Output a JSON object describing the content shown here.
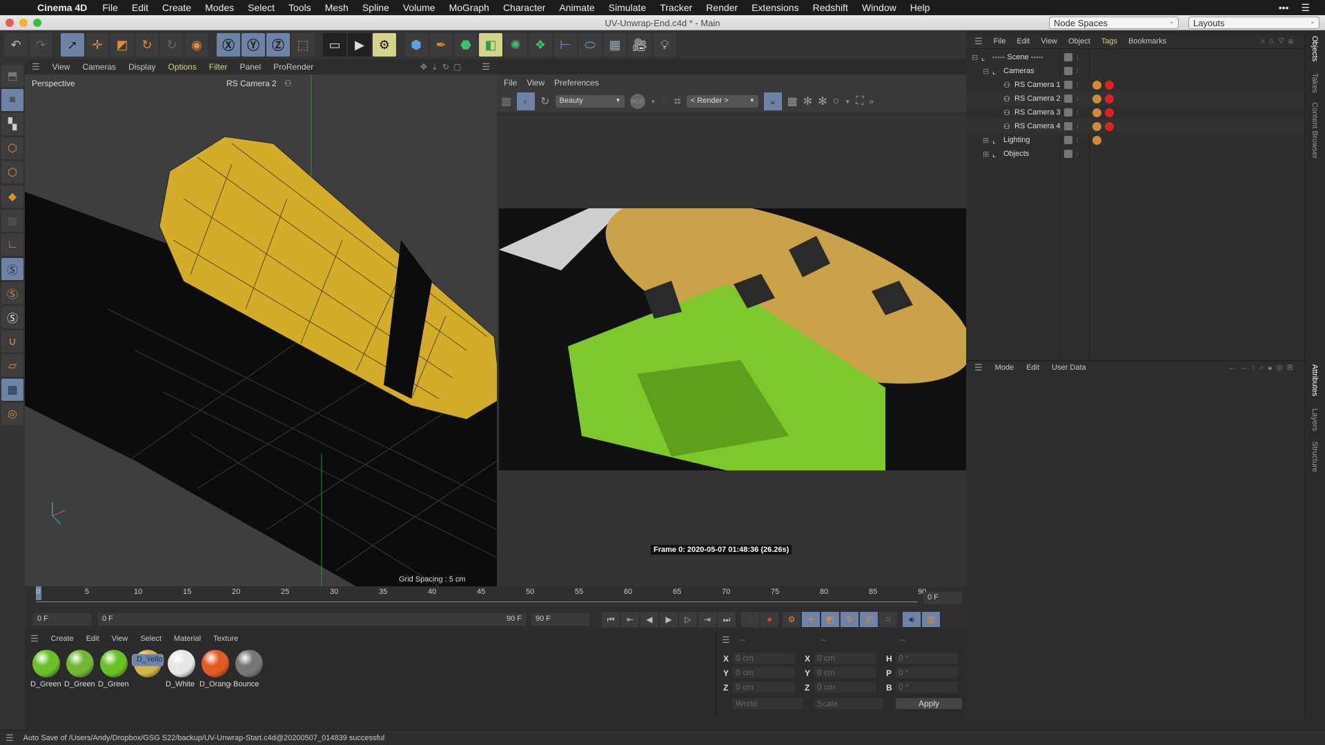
{
  "menubar": {
    "app": "Cinema 4D",
    "items": [
      "File",
      "Edit",
      "Create",
      "Modes",
      "Select",
      "Tools",
      "Mesh",
      "Spline",
      "Volume",
      "MoGraph",
      "Character",
      "Animate",
      "Simulate",
      "Tracker",
      "Render",
      "Extensions",
      "Redshift",
      "Window",
      "Help"
    ]
  },
  "window": {
    "title": "UV-Unwrap-End.c4d * - Main",
    "node_spaces": "Node Spaces",
    "layouts": "Layouts"
  },
  "toolbar": {
    "icons": [
      "undo-icon",
      "redo-icon",
      "live-selection-icon",
      "move-icon",
      "scale-icon",
      "rotate-icon",
      "recent-tool-icon",
      "selection-icon",
      "x-axis-icon",
      "y-axis-icon",
      "z-axis-icon",
      "coordinate-system-icon",
      "render-view-icon",
      "render-picture-viewer-icon",
      "render-settings-icon",
      "cube-icon",
      "pen-icon",
      "subdivision-icon",
      "extrude-icon",
      "cloner-icon",
      "array-icon",
      "deformer-icon",
      "field-icon",
      "floor-icon",
      "camera-icon",
      "light-icon"
    ]
  },
  "viewport": {
    "menu": [
      "View",
      "Cameras",
      "Display",
      "Options",
      "Filter",
      "Panel",
      "ProRender"
    ],
    "name": "Perspective",
    "camera": "RS Camera 2",
    "grid_spacing": "Grid Spacing : 5 cm"
  },
  "render_view": {
    "menu": [
      "File",
      "View",
      "Preferences"
    ],
    "aov": "Beauty",
    "channel": "RGB",
    "render_target": "< Render >",
    "frame_info": "Frame  0:  2020-05-07  01:48:36  (26.26s)"
  },
  "object_manager": {
    "menu": [
      "File",
      "Edit",
      "View",
      "Object",
      "Tags",
      "Bookmarks"
    ],
    "objects": [
      {
        "name": "----- Scene -----",
        "level": 0,
        "expanded": true
      },
      {
        "name": "Cameras",
        "level": 1,
        "expanded": true
      },
      {
        "name": "RS Camera 1",
        "level": 2
      },
      {
        "name": "RS Camera 2",
        "level": 2
      },
      {
        "name": "RS Camera 3",
        "level": 2
      },
      {
        "name": "RS Camera 4",
        "level": 2
      },
      {
        "name": "Lighting",
        "level": 1,
        "expanded": false
      },
      {
        "name": "Objects",
        "level": 1,
        "expanded": false
      }
    ]
  },
  "attributes": {
    "menu": [
      "Mode",
      "Edit",
      "User Data"
    ]
  },
  "side_tabs_top": [
    "Objects",
    "Takes",
    "Content Browser"
  ],
  "side_tabs_bottom": [
    "Attributes",
    "Layers",
    "Structure"
  ],
  "timeline": {
    "ticks": [
      "0",
      "5",
      "10",
      "15",
      "20",
      "25",
      "30",
      "35",
      "40",
      "45",
      "50",
      "55",
      "60",
      "65",
      "70",
      "75",
      "80",
      "85",
      "90"
    ],
    "current_frame": "0 F",
    "start": "0 F",
    "range_start": "0 F",
    "range_end": "90 F",
    "end": "90 F",
    "current_frame_value": 0,
    "max_frame": 90
  },
  "material_manager": {
    "menu": [
      "Create",
      "Edit",
      "View",
      "Select",
      "Material",
      "Texture"
    ],
    "materials": [
      {
        "name": "D_Green",
        "color": "#6cc12a"
      },
      {
        "name": "D_Green",
        "color": "#72b832"
      },
      {
        "name": "D_Green",
        "color": "#68c224"
      },
      {
        "name": "D_Yellow",
        "color": "#d4b44a",
        "selected": true
      },
      {
        "name": "D_White",
        "color": "#e6e6e6"
      },
      {
        "name": "D_Orange",
        "color": "#e45a22"
      },
      {
        "name": "Bounce",
        "color": "#777777"
      }
    ]
  },
  "coordinates": {
    "headers": [
      "--",
      "--",
      "--"
    ],
    "position": {
      "X": "0 cm",
      "Y": "0 cm",
      "Z": "0 cm"
    },
    "size": {
      "X": "0 cm",
      "Y": "0 cm",
      "Z": "0 cm"
    },
    "rotation": {
      "H": "0 °",
      "P": "0 °",
      "B": "0 °"
    },
    "space": "World",
    "mode": "Scale",
    "apply": "Apply"
  },
  "status": "Auto Save of /Users/Andy/Dropbox/GSG S22/backup/UV-Unwrap-Start.c4d@20200507_014839 successful"
}
